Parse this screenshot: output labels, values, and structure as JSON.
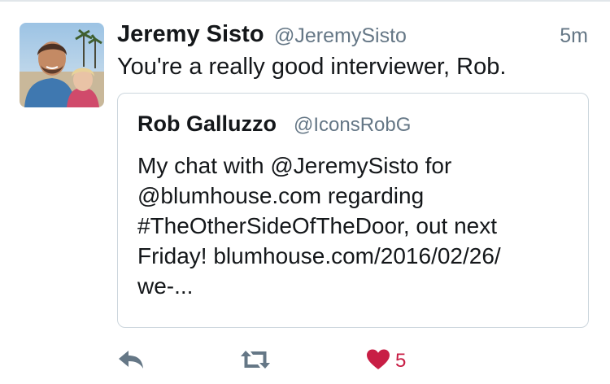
{
  "tweet": {
    "author": {
      "display_name": "Jeremy Sisto",
      "handle": "@JeremySisto",
      "avatar_icon": "profile-photo"
    },
    "timestamp": "5m",
    "text": "You're a really good interviewer, Rob."
  },
  "quoted_tweet": {
    "author": {
      "display_name": "Rob Galluzzo",
      "handle": "@IconsRobG"
    },
    "text_lines": [
      "My chat with @JeremySisto for",
      "@blumhouse.com regarding",
      "#TheOtherSideOfTheDoor, out next",
      "Friday! blumhouse.com/2016/02/26/",
      "we-..."
    ]
  },
  "actions": {
    "reply_icon": "reply-arrow-icon",
    "retweet_icon": "retweet-icon",
    "like_icon": "heart-icon",
    "like_count": "5"
  },
  "colors": {
    "text_primary": "#14171a",
    "text_secondary": "#657786",
    "border": "#ccd6dd",
    "icon_gray": "#657786",
    "like_red": "#c81e45"
  }
}
